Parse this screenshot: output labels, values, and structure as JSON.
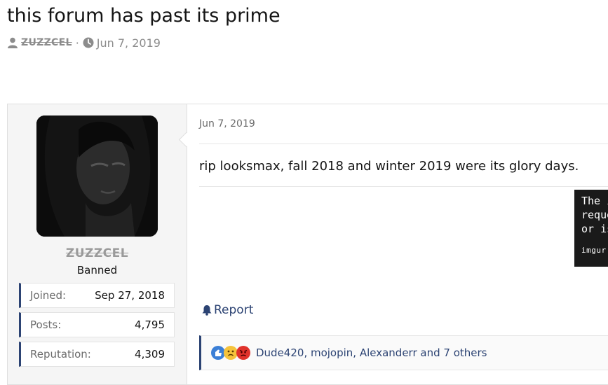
{
  "thread": {
    "title": "this forum has past its prime",
    "author": "ZUZZCEL",
    "date": "Jun 7, 2019",
    "separator": "·"
  },
  "post": {
    "date": "Jun 7, 2019",
    "body": "rip looksmax, fall 2018 and winter 2019 were its glory days.",
    "report_label": "Report",
    "embed": {
      "lines": [
        "The i",
        "reque",
        "or is"
      ],
      "brand": "imgur"
    },
    "reactions": {
      "icons": [
        "like-icon",
        "sad-icon",
        "angry-icon"
      ],
      "text": "Dude420, mojopin, Alexanderr and 7 others"
    }
  },
  "user": {
    "name": "ZUZZCEL",
    "title": "Banned",
    "stats": [
      {
        "label": "Joined:",
        "value": "Sep 27, 2018"
      },
      {
        "label": "Posts:",
        "value": "4,795"
      },
      {
        "label": "Reputation:",
        "value": "4,309"
      }
    ]
  },
  "colors": {
    "accent": "#2c4373",
    "muted": "#8c8c8c",
    "panel": "#f5f5f5"
  }
}
